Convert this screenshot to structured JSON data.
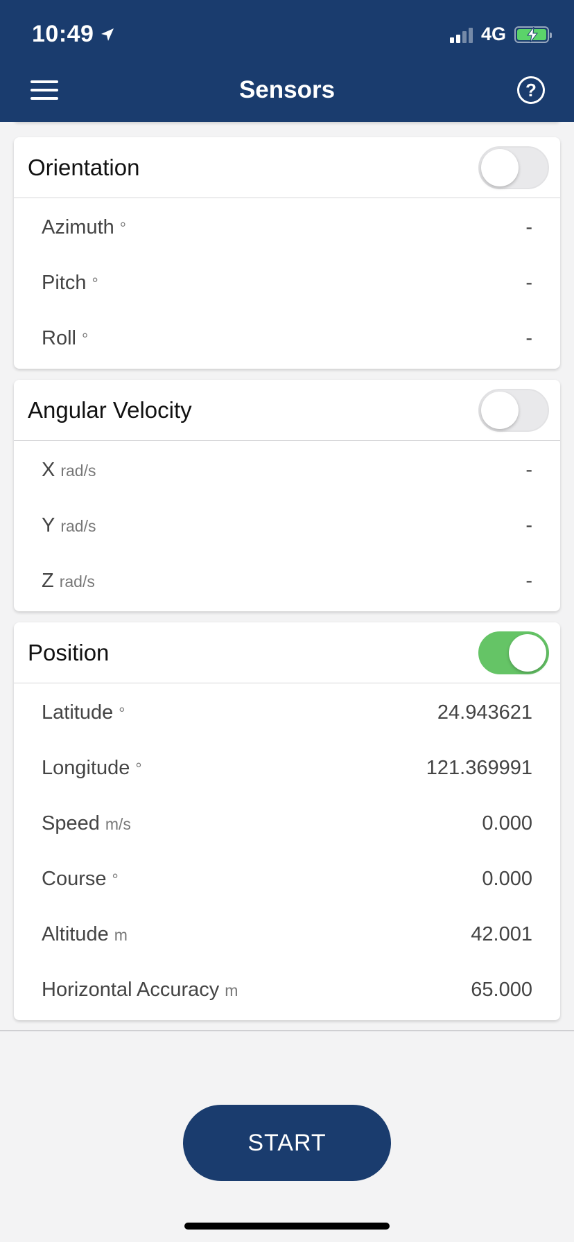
{
  "status_bar": {
    "time": "10:49",
    "network": "4G",
    "location_icon": "location-arrow-icon",
    "battery_color": "#5bd36a"
  },
  "header": {
    "title": "Sensors",
    "menu_icon": "hamburger-menu-icon",
    "help_icon": "help-circle-icon",
    "help_glyph": "?",
    "background": "#1a3c6e"
  },
  "sections": {
    "orientation": {
      "title": "Orientation",
      "enabled": false,
      "rows": [
        {
          "label": "Azimuth",
          "unit": "°",
          "value": "-"
        },
        {
          "label": "Pitch",
          "unit": "°",
          "value": "-"
        },
        {
          "label": "Roll",
          "unit": "°",
          "value": "-"
        }
      ]
    },
    "angular_velocity": {
      "title": "Angular Velocity",
      "enabled": false,
      "rows": [
        {
          "label": "X",
          "unit": "rad/s",
          "value": "-"
        },
        {
          "label": "Y",
          "unit": "rad/s",
          "value": "-"
        },
        {
          "label": "Z",
          "unit": "rad/s",
          "value": "-"
        }
      ]
    },
    "position": {
      "title": "Position",
      "enabled": true,
      "rows": [
        {
          "label": "Latitude",
          "unit": "°",
          "value": "24.943621"
        },
        {
          "label": "Longitude",
          "unit": "°",
          "value": "121.369991"
        },
        {
          "label": "Speed",
          "unit": "m/s",
          "value": "0.000"
        },
        {
          "label": "Course",
          "unit": "°",
          "value": "0.000"
        },
        {
          "label": "Altitude",
          "unit": "m",
          "value": "42.001"
        },
        {
          "label": "Horizontal Accuracy",
          "unit": "m",
          "value": "65.000"
        }
      ]
    }
  },
  "start_button": {
    "label": "START",
    "color": "#1a3c6e"
  },
  "toggle_on_color": "#65c466"
}
